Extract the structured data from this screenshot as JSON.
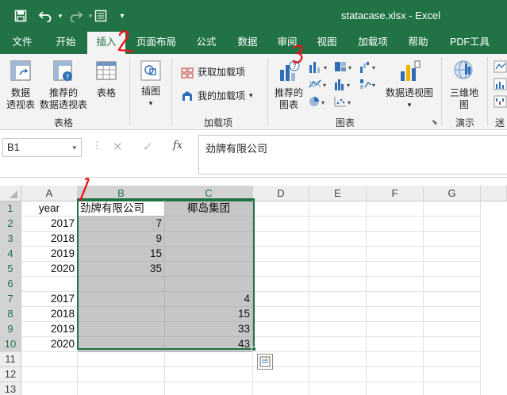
{
  "window": {
    "title": "statacase.xlsx  -  Excel"
  },
  "tabs": [
    {
      "label": "文件"
    },
    {
      "label": "开始"
    },
    {
      "label": "插入"
    },
    {
      "label": "页面布局"
    },
    {
      "label": "公式"
    },
    {
      "label": "数据"
    },
    {
      "label": "审阅"
    },
    {
      "label": "视图"
    },
    {
      "label": "加载项"
    },
    {
      "label": "帮助"
    },
    {
      "label": "PDF工具"
    }
  ],
  "active_tab": "插入",
  "ribbon": {
    "tables": {
      "pivot_line1": "数据",
      "pivot_line2": "透视表",
      "recommended_line1": "推荐的",
      "recommended_line2": "数据透视表",
      "table": "表格",
      "group": "表格"
    },
    "illustrations": {
      "label": "插图"
    },
    "addins": {
      "get": "获取加载项",
      "my": "我的加载项",
      "group": "加载项"
    },
    "charts": {
      "recommended_line1": "推荐的",
      "recommended_line2": "图表",
      "pivot_chart": "数据透视图",
      "group": "图表"
    },
    "tours": {
      "map_line1": "三维地",
      "map_line2": "图",
      "group": "演示"
    },
    "sparklines": {
      "group": "迷"
    }
  },
  "formula_bar": {
    "name_box": "B1",
    "fx": "fx",
    "content": "劲牌有限公司"
  },
  "columns": [
    "A",
    "B",
    "C",
    "D",
    "E",
    "F",
    "G"
  ],
  "selected_columns": [
    "B",
    "C"
  ],
  "rows": [
    "1",
    "2",
    "3",
    "4",
    "5",
    "6",
    "7",
    "8",
    "9",
    "10",
    "11",
    "12",
    "13"
  ],
  "selected_rows": [
    "1",
    "2",
    "3",
    "4",
    "5",
    "6",
    "7",
    "8",
    "9",
    "10"
  ],
  "cells": [
    [
      "year",
      "劲牌有限公司",
      "椰岛集团"
    ],
    [
      "2017",
      "7",
      ""
    ],
    [
      "2018",
      "9",
      ""
    ],
    [
      "2019",
      "15",
      ""
    ],
    [
      "2020",
      "35",
      ""
    ],
    [
      "",
      "",
      ""
    ],
    [
      "2017",
      "",
      "4"
    ],
    [
      "2018",
      "",
      "15"
    ],
    [
      "2019",
      "",
      "33"
    ],
    [
      "2020",
      "",
      "43"
    ],
    [
      "",
      "",
      ""
    ],
    [
      "",
      "",
      ""
    ],
    [
      "",
      "",
      ""
    ]
  ],
  "annotations": [
    "1",
    "2",
    "3"
  ],
  "colors": {
    "accent": "#217346",
    "annotation": "#e8141b",
    "selection": "#c6c6c6"
  }
}
